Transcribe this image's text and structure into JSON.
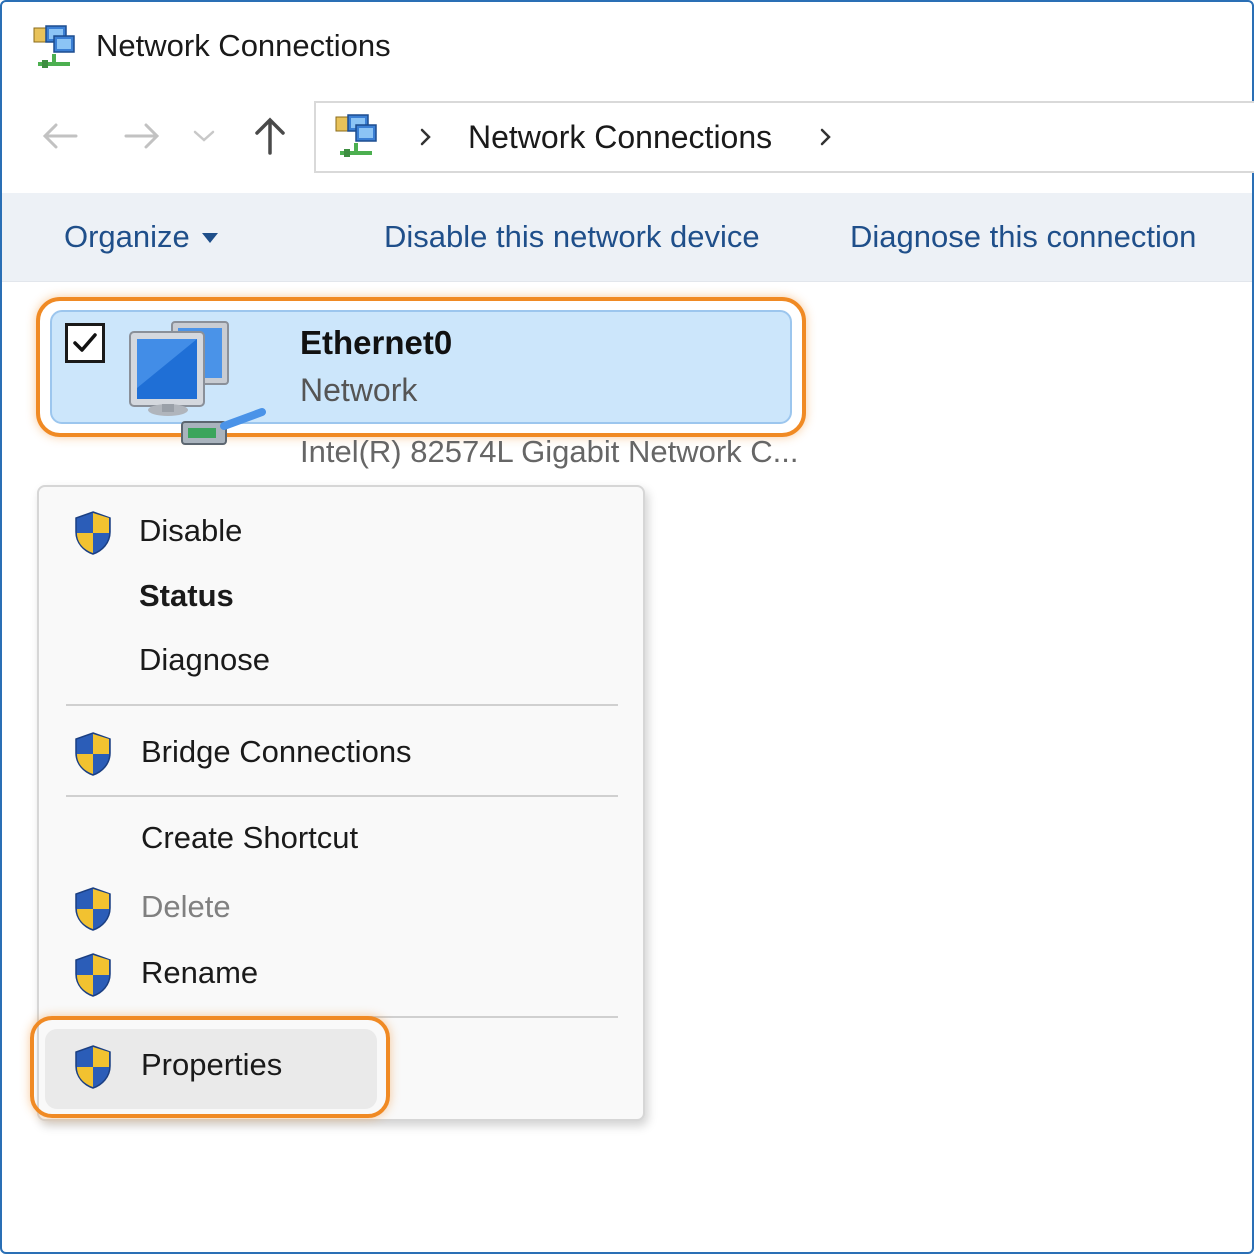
{
  "window": {
    "title": "Network Connections"
  },
  "nav": {
    "back_icon": "arrow-left-icon",
    "forward_icon": "arrow-right-icon",
    "recent_icon": "chevron-down-icon",
    "up_icon": "arrow-up-icon"
  },
  "address": {
    "segment": "Network Connections"
  },
  "commands": {
    "organize": "Organize",
    "disable_device": "Disable this network device",
    "diagnose": "Diagnose this connection"
  },
  "connection": {
    "name": "Ethernet0",
    "status": "Network",
    "device": "Intel(R) 82574L Gigabit Network C...",
    "checked": true
  },
  "context_menu": {
    "disable": "Disable",
    "status": "Status",
    "diagnose": "Diagnose",
    "bridge": "Bridge Connections",
    "create_shortcut": "Create Shortcut",
    "delete": "Delete",
    "rename": "Rename",
    "properties": "Properties"
  },
  "colors": {
    "highlight_orange": "#f08a24",
    "selection_blue": "#cce6fb",
    "command_text": "#1f4f8a"
  }
}
